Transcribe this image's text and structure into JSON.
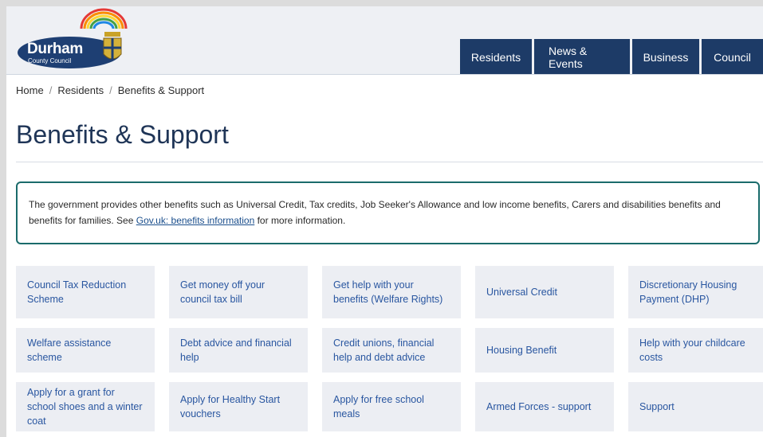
{
  "logo": {
    "name": "Durham",
    "subtitle": "County Council"
  },
  "nav": {
    "tabs": [
      "Residents",
      "News & Events",
      "Business",
      "Council"
    ]
  },
  "breadcrumb": {
    "items": [
      "Home",
      "Residents",
      "Benefits & Support"
    ],
    "separator": "/"
  },
  "page": {
    "title": "Benefits & Support"
  },
  "info": {
    "text_before": "The government provides other benefits such as Universal Credit, Tax credits, Job Seeker's Allowance and low income benefits, Carers and disabilities benefits and benefits for families. See ",
    "link_text": "Gov.uk: benefits information",
    "text_after": " for more information."
  },
  "cards": [
    "Council Tax Reduction Scheme",
    "Get money off your council tax bill",
    "Get help with your benefits (Welfare Rights)",
    "Universal Credit",
    "Discretionary Housing Payment (DHP)",
    "Welfare assistance scheme",
    "Debt advice and financial help",
    "Credit unions, financial help and debt advice",
    "Housing Benefit",
    "Help with your childcare costs",
    "Apply for a grant for school shoes and a winter coat",
    "Apply for Healthy Start vouchers",
    "Apply for free school meals",
    "Armed Forces - support",
    "Support"
  ],
  "colors": {
    "nav_bg": "#1d3b67",
    "title": "#1f3557",
    "info_border": "#1a6b6b",
    "card_bg": "#eceef3",
    "card_text": "#2956a0"
  }
}
